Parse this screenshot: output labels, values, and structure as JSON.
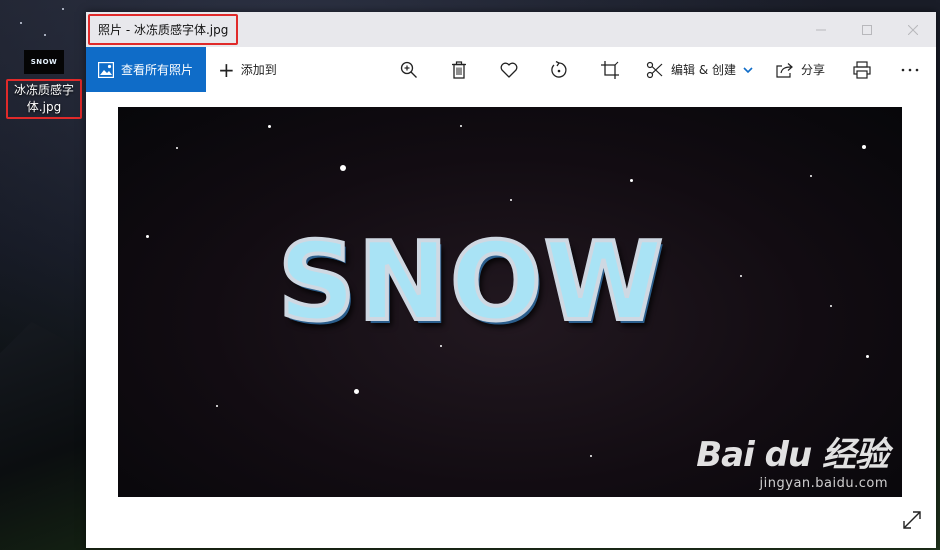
{
  "desktop": {
    "icon_thumb_text": "SNOW",
    "icon_label": "冰冻质感字体.jpg"
  },
  "window": {
    "title": "照片 - 冰冻质感字体.jpg"
  },
  "toolbar": {
    "view_all_label": "查看所有照片",
    "add_to_label": "添加到",
    "edit_create_label": "编辑 & 创建",
    "share_label": "分享"
  },
  "photo": {
    "headline": "SNOW"
  },
  "watermark": {
    "main": "Bai du 经验",
    "sub": "jingyan.baidu.com"
  },
  "colors": {
    "accent": "#0f6cc8",
    "highlight": "#e02a2a"
  },
  "icons": [
    "image-icon",
    "plus-icon",
    "zoom-in-icon",
    "delete-icon",
    "heart-icon",
    "rotate-icon",
    "crop-icon",
    "edit-icon",
    "chevron-down-icon",
    "share-icon",
    "print-icon",
    "more-icon",
    "expand-icon"
  ]
}
